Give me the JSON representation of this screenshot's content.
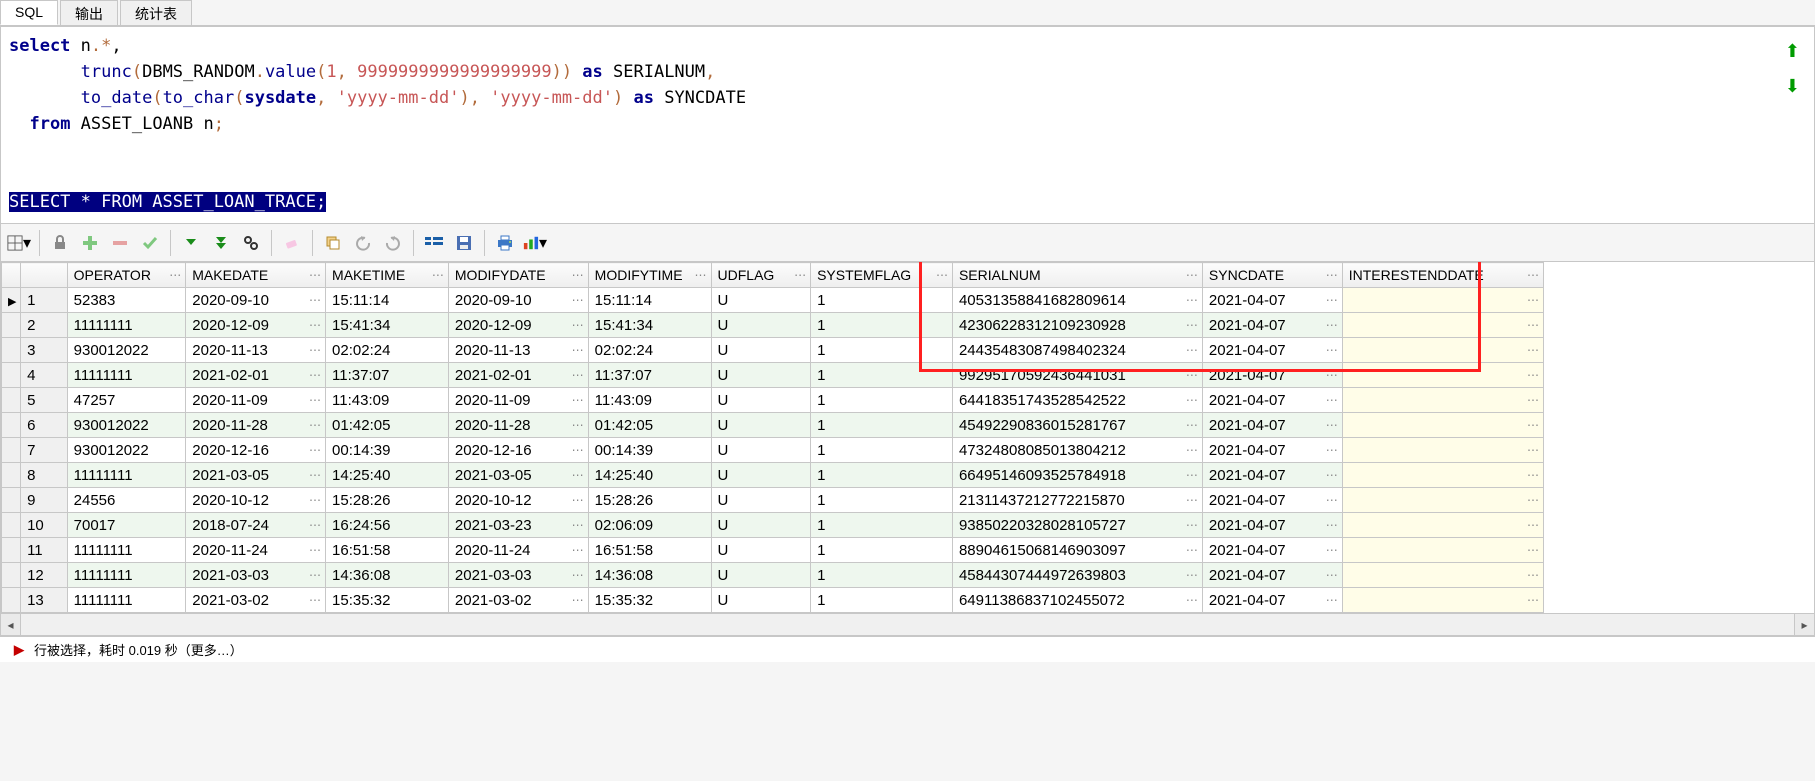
{
  "tabs": {
    "sql": "SQL",
    "output": "输出",
    "stats": "统计表"
  },
  "sql": {
    "l1a": "select",
    "l1b": " n",
    "l1c": ".*",
    "l1d": ",",
    "l2a": "trunc",
    "l2b": "(",
    "l2c": "DBMS_RANDOM",
    "l2d": ".",
    "l2e": "value",
    "l2f": "(",
    "l2g": "1",
    "l2h": ",",
    "l2i": " 9999999999999999999",
    "l2j": "))",
    "l2k": " as",
    "l2l": " SERIALNUM",
    "l2m": ",",
    "l3a": "to_date",
    "l3b": "(",
    "l3c": "to_char",
    "l3d": "(",
    "l3e": "sysdate",
    "l3f": ",",
    "l3g": " 'yyyy-mm-dd'",
    "l3h": ")",
    "l3i": ",",
    "l3j": " 'yyyy-mm-dd'",
    "l3k": ")",
    "l3l": " as",
    "l3m": " SYNCDATE",
    "l4a": "from",
    "l4b": " ASSET_LOANB n",
    "l4c": ";",
    "hl": "SELECT * FROM ASSET_LOAN_TRACE;"
  },
  "cols": {
    "operator": "OPERATOR",
    "makedate": "MAKEDATE",
    "maketime": "MAKETIME",
    "modifydate": "MODIFYDATE",
    "modifytime": "MODIFYTIME",
    "udflag": "UDFLAG",
    "systemflag": "SYSTEMFLAG",
    "serialnum": "SERIALNUM",
    "syncdate": "SYNCDATE",
    "interestend": "INTERESTENDDATE"
  },
  "rows": [
    {
      "n": "1",
      "op": "52383",
      "md": "2020-09-10",
      "mt": "15:11:14",
      "fd": "2020-09-10",
      "ft": "15:11:14",
      "u": "U",
      "s": "1",
      "sn": "40531358841682809614",
      "sd": "2021-04-07"
    },
    {
      "n": "2",
      "op": "11111111",
      "md": "2020-12-09",
      "mt": "15:41:34",
      "fd": "2020-12-09",
      "ft": "15:41:34",
      "u": "U",
      "s": "1",
      "sn": "42306228312109230928",
      "sd": "2021-04-07"
    },
    {
      "n": "3",
      "op": "930012022",
      "md": "2020-11-13",
      "mt": "02:02:24",
      "fd": "2020-11-13",
      "ft": "02:02:24",
      "u": "U",
      "s": "1",
      "sn": "24435483087498402324",
      "sd": "2021-04-07"
    },
    {
      "n": "4",
      "op": "11111111",
      "md": "2021-02-01",
      "mt": "11:37:07",
      "fd": "2021-02-01",
      "ft": "11:37:07",
      "u": "U",
      "s": "1",
      "sn": "99295170592436441031",
      "sd": "2021-04-07"
    },
    {
      "n": "5",
      "op": "47257",
      "md": "2020-11-09",
      "mt": "11:43:09",
      "fd": "2020-11-09",
      "ft": "11:43:09",
      "u": "U",
      "s": "1",
      "sn": "64418351743528542522",
      "sd": "2021-04-07"
    },
    {
      "n": "6",
      "op": "930012022",
      "md": "2020-11-28",
      "mt": "01:42:05",
      "fd": "2020-11-28",
      "ft": "01:42:05",
      "u": "U",
      "s": "1",
      "sn": "45492290836015281767",
      "sd": "2021-04-07"
    },
    {
      "n": "7",
      "op": "930012022",
      "md": "2020-12-16",
      "mt": "00:14:39",
      "fd": "2020-12-16",
      "ft": "00:14:39",
      "u": "U",
      "s": "1",
      "sn": "47324808085013804212",
      "sd": "2021-04-07"
    },
    {
      "n": "8",
      "op": "11111111",
      "md": "2021-03-05",
      "mt": "14:25:40",
      "fd": "2021-03-05",
      "ft": "14:25:40",
      "u": "U",
      "s": "1",
      "sn": "66495146093525784918",
      "sd": "2021-04-07"
    },
    {
      "n": "9",
      "op": "24556",
      "md": "2020-10-12",
      "mt": "15:28:26",
      "fd": "2020-10-12",
      "ft": "15:28:26",
      "u": "U",
      "s": "1",
      "sn": "21311437212772215870",
      "sd": "2021-04-07"
    },
    {
      "n": "10",
      "op": "70017",
      "md": "2018-07-24",
      "mt": "16:24:56",
      "fd": "2021-03-23",
      "ft": "02:06:09",
      "u": "U",
      "s": "1",
      "sn": "93850220328028105727",
      "sd": "2021-04-07"
    },
    {
      "n": "11",
      "op": "11111111",
      "md": "2020-11-24",
      "mt": "16:51:58",
      "fd": "2020-11-24",
      "ft": "16:51:58",
      "u": "U",
      "s": "1",
      "sn": "88904615068146903097",
      "sd": "2021-04-07"
    },
    {
      "n": "12",
      "op": "11111111",
      "md": "2021-03-03",
      "mt": "14:36:08",
      "fd": "2021-03-03",
      "ft": "14:36:08",
      "u": "U",
      "s": "1",
      "sn": "45844307444972639803",
      "sd": "2021-04-07"
    },
    {
      "n": "13",
      "op": "11111111",
      "md": "2021-03-02",
      "mt": "15:35:32",
      "fd": "2021-03-02",
      "ft": "15:35:32",
      "u": "U",
      "s": "1",
      "sn": "64911386837102455072",
      "sd": "2021-04-07"
    }
  ],
  "status": {
    "dot": "▶",
    "text": "  行被选择，耗时 0.019 秒（更多…）"
  }
}
